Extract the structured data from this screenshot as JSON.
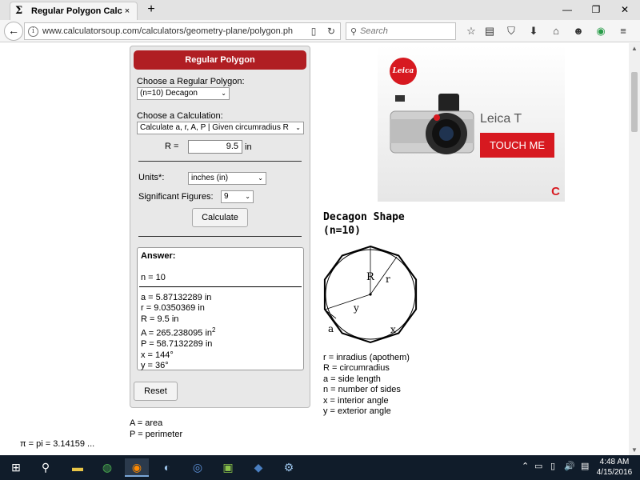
{
  "browser": {
    "tab": {
      "icon": "sigma-icon",
      "title": "Regular Polygon Calculator",
      "close": "×"
    },
    "newtab": "+",
    "window_controls": {
      "minimize": "—",
      "restore": "❐",
      "close": "✕"
    },
    "back": "←",
    "url": "www.calculatorsoup.com/calculators/geometry-plane/polygon.ph",
    "reader": "▯",
    "reload": "↻",
    "search_placeholder": "Search",
    "toolbar_icons": {
      "bookmark": "☆",
      "bookmarks_list": "▤",
      "pocket": "⛉",
      "download": "⬇",
      "home": "⌂",
      "chat": "☻",
      "extension": "◉",
      "menu": "≡"
    }
  },
  "calc": {
    "header": "Regular Polygon",
    "polygon_label": "Choose a Regular Polygon:",
    "polygon_value": "(n=10) Decagon",
    "calculation_label": "Choose a Calculation:",
    "calculation_value": "Calculate a, r, A, P | Given circumradius R",
    "r_label": "R =",
    "r_value": "9.5",
    "r_unit": "in",
    "units_label": "Units*:",
    "units_value": "inches (in)",
    "sigfig_label": "Significant Figures:",
    "sigfig_value": "9",
    "calculate": "Calculate",
    "reset": "Reset",
    "answer_title": "Answer:",
    "n_line": "n = 10",
    "results": {
      "a": "a = 5.87132289 in",
      "r": "r = 9.0350369 in",
      "R": "R = 9.5 in",
      "A": "A = 265.238095 in",
      "A_sup": "2",
      "P": "P = 58.7132289 in",
      "x": "x = 144°",
      "y": "y = 36°"
    }
  },
  "below": {
    "area": "A = area",
    "perimeter": "P = perimeter",
    "pi": "π = pi = 3.14159 ..."
  },
  "ad": {
    "logo": "Leica",
    "brand": "Leica T",
    "cta": "TOUCH ME",
    "adchoice": "C"
  },
  "shape": {
    "title1": "Decagon Shape",
    "title2": "(n=10)",
    "labels": {
      "R": "R",
      "r": "r",
      "y": "y",
      "a": "a",
      "x": "x"
    }
  },
  "legend": {
    "r": "r = inradius (apothem)",
    "R": "R = circumradius",
    "a": "a = side length",
    "n": "n = number of sides",
    "x": "x = interior angle",
    "y": "y = exterior angle"
  },
  "taskbar": {
    "start": "⊞",
    "search": "⚲",
    "explorer": "▬",
    "chrome": "◍",
    "firefox": "◉",
    "app1": "◐",
    "app2": "◎",
    "app3": "▣",
    "app4": "◆",
    "app5": "⚙",
    "tray": {
      "chevron": "⌃",
      "network": "▭",
      "battery": "▯",
      "volume": "🔊",
      "notifications": "▤"
    },
    "time": "4:48 AM",
    "date": "4/15/2016"
  }
}
